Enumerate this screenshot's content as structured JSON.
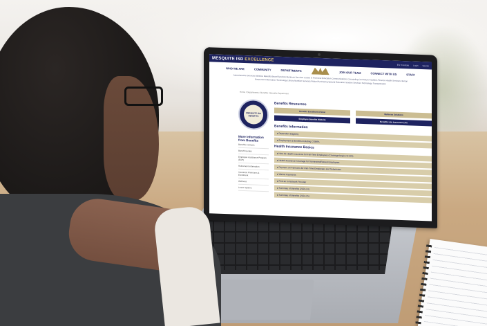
{
  "website": {
    "brand_main": "MESQUITE ISD",
    "brand_accent": "EXCELLENCE",
    "topbar_links": [
      "EN Translate",
      "Login",
      "Search"
    ],
    "nav_left": [
      "WHO WE ARE",
      "COMMUNITY",
      "DEPARTMENTS"
    ],
    "nav_right": [
      "JOIN OUR TEAM",
      "CONNECT WITH US",
      "STAFF"
    ],
    "subnav": "Administrative Services   Athletics   Benefits   Board Services   Business Services   Career & Technical Education   Communications   Counseling   Curriculum   Facilities   Finance   Health Services   Human Resources   Information Technology   Library   Nutrition Services   Police   Purchasing   Special Education   Student Services   Technology   Transportation",
    "breadcrumb": "Home  /  Departments  /  Benefits  /  Benefits Department",
    "seal_text": "MESQUITE ISD BENEFITS",
    "sidebar_title": "More Information from Benefits",
    "sidebar_links": [
      "Benefits Contacts",
      "Benefit Guides",
      "Employee Assistance Program (EAP)",
      "Retirement Information",
      "Insurance Premiums & Enrollment",
      "Wellness",
      "Leave Options"
    ],
    "resources_title": "Benefits Resources",
    "resource_buttons": [
      {
        "label": "Benefits Enrollment Portal",
        "style": "gold"
      },
      {
        "label": "Wellness Solutions",
        "style": "gold"
      },
      {
        "label": "Employee Benefits Website",
        "style": "navy"
      },
      {
        "label": "Benefits Life Insurance Line",
        "style": "navy"
      }
    ],
    "info_title": "Benefits Information",
    "info_items": [
      "Dependent Eligibility",
      "Employment & Benefits Including COBRA"
    ],
    "health_title": "Health Insurance Basics",
    "health_items": [
      "How do Health Insurance for Full-Time Employees (Coverage begins 9/1/23)",
      "Health Insurance Coverage for Terminated/Retired Employees",
      "Payment of Premiums for Part-Time Employees and Substitutes",
      "Waiver Payments",
      "Find an In-Network Provider",
      "Summary of Benefits (2023-24)",
      "Summary of Benefits (2024-25)"
    ]
  },
  "colors": {
    "navy": "#1e2360",
    "gold": "#cbbd92",
    "desk": "#c9a880"
  }
}
